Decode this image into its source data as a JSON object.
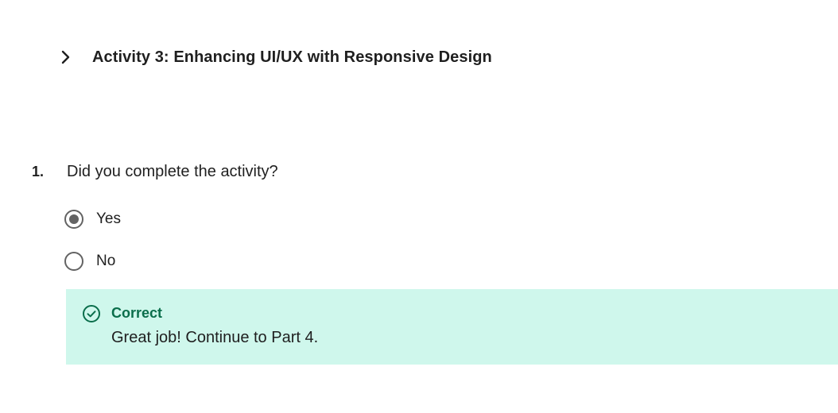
{
  "activity": {
    "title": "Activity 3: Enhancing UI/UX with Responsive Design",
    "expand_icon": "chevron-right-icon"
  },
  "question": {
    "number": "1.",
    "text": "Did you complete the activity?",
    "options": [
      {
        "label": "Yes",
        "selected": true
      },
      {
        "label": "No",
        "selected": false
      }
    ]
  },
  "feedback": {
    "icon": "check-circle-icon",
    "title": "Correct",
    "message": "Great job! Continue to Part 4.",
    "background_color": "#cff7ec",
    "title_color": "#0a6e4b"
  }
}
